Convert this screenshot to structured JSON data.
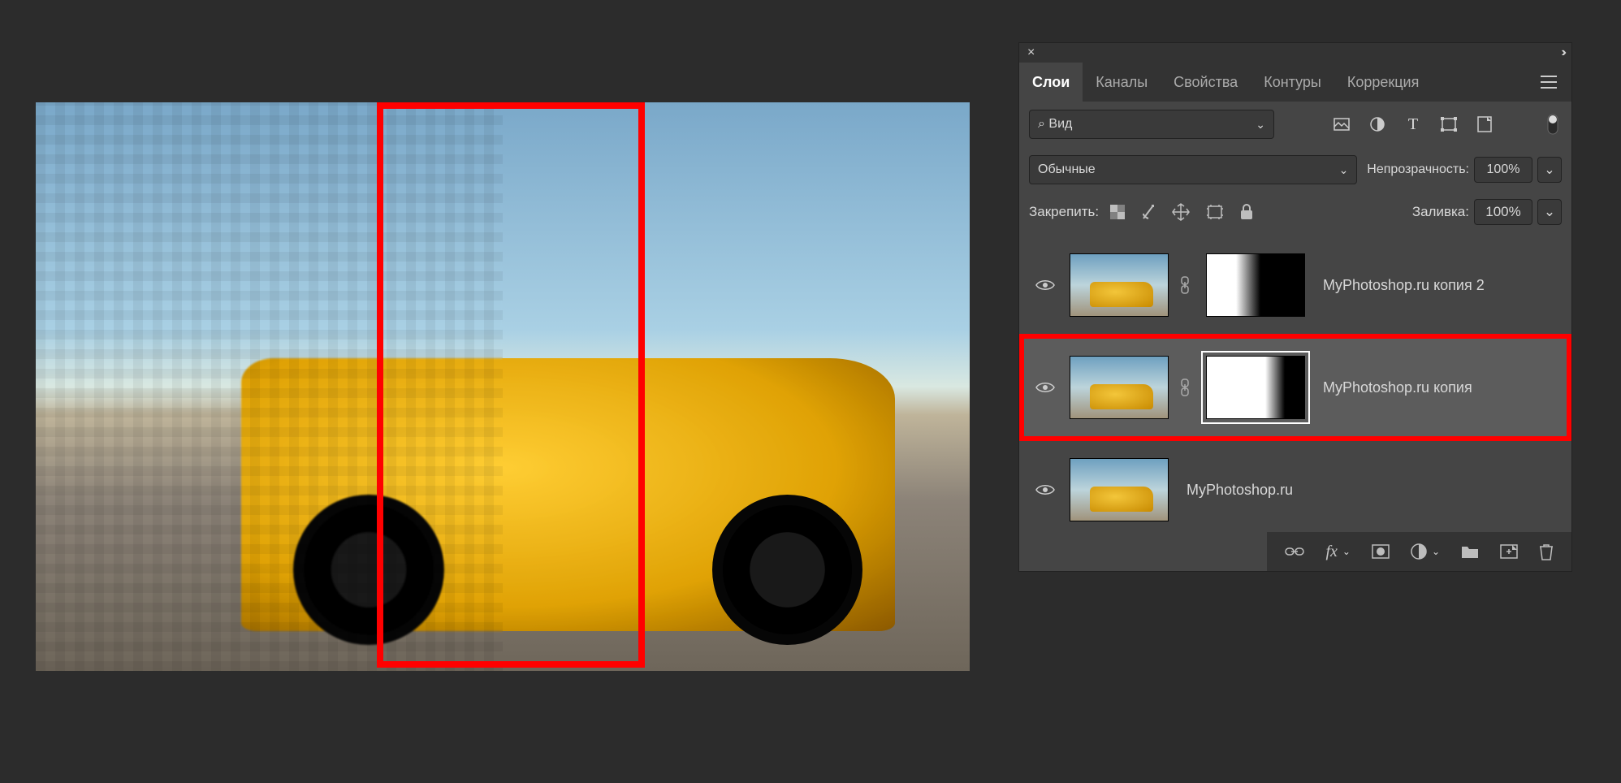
{
  "tabs": {
    "layers": "Слои",
    "channels": "Каналы",
    "properties": "Свойства",
    "paths": "Контуры",
    "adjustments": "Коррекция"
  },
  "layerKind": {
    "searchGlyph": "⌕",
    "label": "Вид"
  },
  "blend": {
    "mode": "Обычные",
    "opacityLabel": "Непрозрачность:",
    "opacityValue": "100%"
  },
  "lock": {
    "label": "Закрепить:",
    "fillLabel": "Заливка:",
    "fillValue": "100%"
  },
  "layers": [
    {
      "name": "MyPhotoshop.ru копия 2",
      "hasMask": true,
      "maskKind": "m1",
      "selected": false
    },
    {
      "name": "MyPhotoshop.ru копия",
      "hasMask": true,
      "maskKind": "m2",
      "selected": true
    },
    {
      "name": "MyPhotoshop.ru",
      "hasMask": false,
      "maskKind": "",
      "selected": false
    }
  ],
  "fxGlyph": "fx"
}
